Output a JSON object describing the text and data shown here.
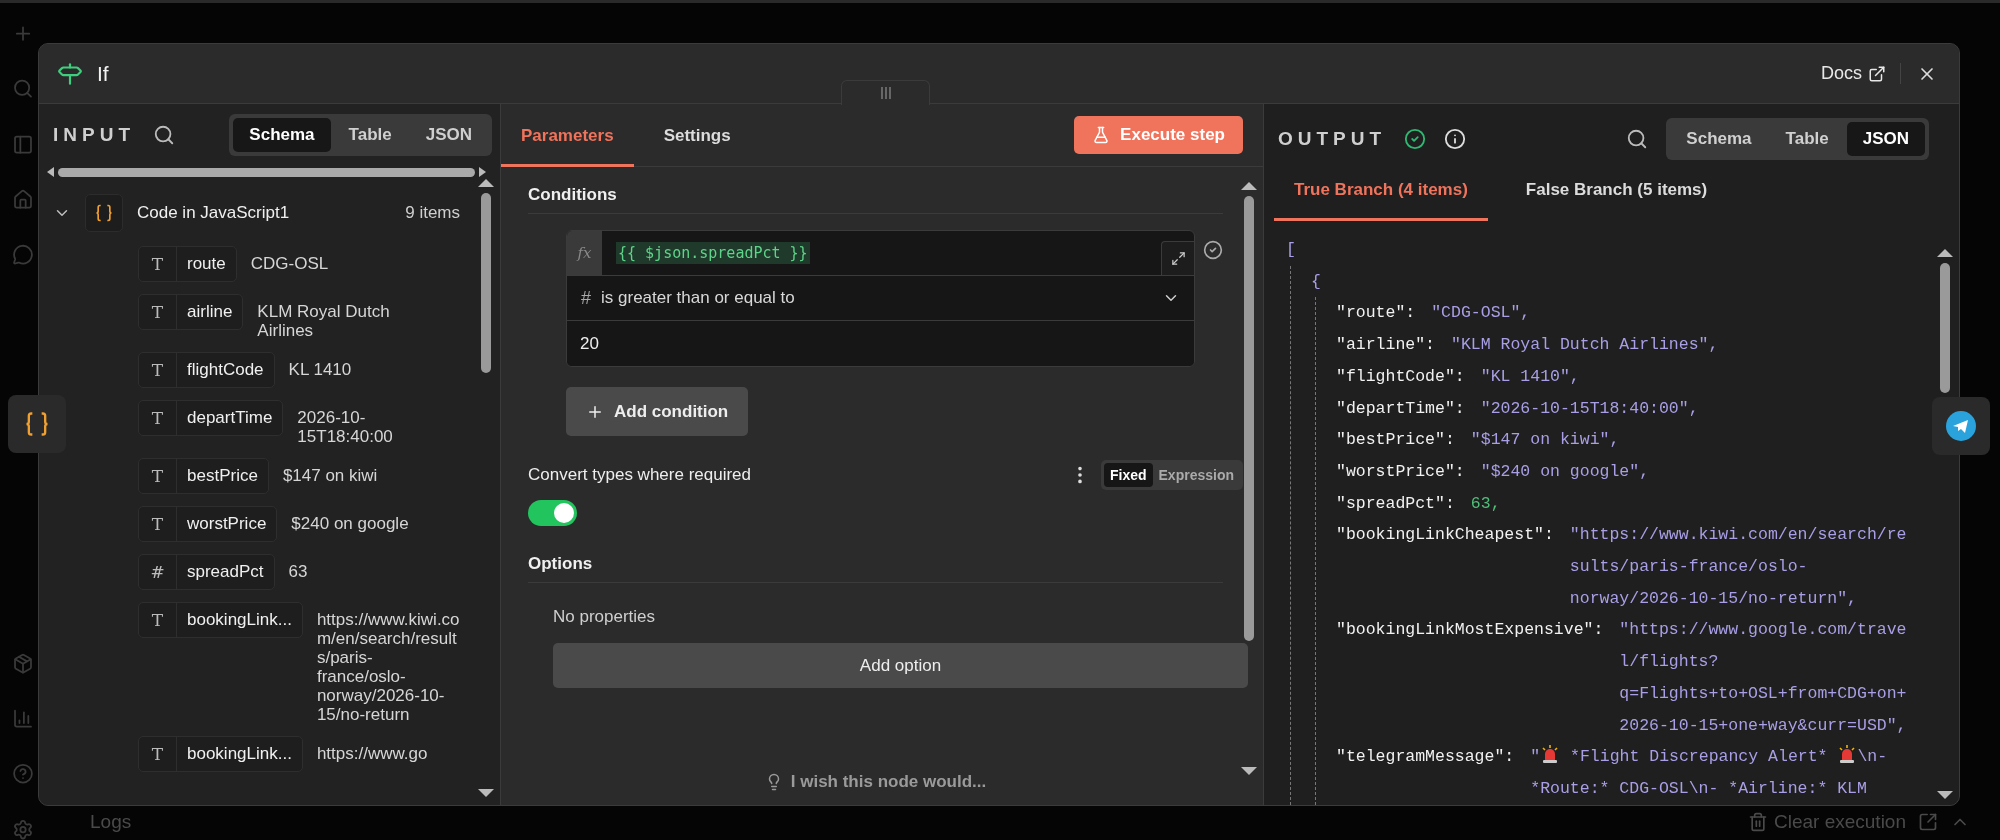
{
  "window": {
    "title": "If",
    "docs_link": "Docs"
  },
  "input": {
    "title": "INPUT",
    "views": [
      {
        "label": "Schema",
        "selected": true
      },
      {
        "label": "Table",
        "selected": false
      },
      {
        "label": "JSON",
        "selected": false
      }
    ],
    "source": {
      "name": "Code in JavaScript1",
      "count": "9 items",
      "expanded": true
    },
    "fields": [
      {
        "type_symbol": "T",
        "name": "route",
        "value": "CDG-OSL"
      },
      {
        "type_symbol": "T",
        "name": "airline",
        "value": "KLM Royal Dutch Airlines"
      },
      {
        "type_symbol": "T",
        "name": "flightCode",
        "value": "KL 1410"
      },
      {
        "type_symbol": "T",
        "name": "departTime",
        "value": "2026-10-15T18:40:00"
      },
      {
        "type_symbol": "T",
        "name": "bestPrice",
        "value": "$147 on kiwi"
      },
      {
        "type_symbol": "T",
        "name": "worstPrice",
        "value": "$240 on google"
      },
      {
        "type_symbol": "#",
        "name": "spreadPct",
        "value": "63"
      },
      {
        "type_symbol": "T",
        "name": "bookingLink...",
        "value": "https://www.kiwi.com/en/search/results/paris-france/oslo-norway/2026-10-15/no-return"
      },
      {
        "type_symbol": "T",
        "name": "bookingLink...",
        "value": "https://www.go"
      }
    ]
  },
  "parameters": {
    "tabs": [
      {
        "label": "Parameters",
        "selected": true
      },
      {
        "label": "Settings",
        "selected": false
      }
    ],
    "execute_button": "Execute step",
    "conditions": {
      "title": "Conditions",
      "expression_badge": "fx",
      "expression": "{{ $json.spreadPct }}",
      "operator_symbol": "#",
      "operator": "is greater than or equal to",
      "value": "20",
      "add_button": "Add condition"
    },
    "convert": {
      "label": "Convert types where required",
      "on": true,
      "modes": [
        {
          "label": "Fixed",
          "selected": true
        },
        {
          "label": "Expression",
          "selected": false
        }
      ]
    },
    "options": {
      "title": "Options",
      "empty_text": "No properties",
      "add_button": "Add option"
    },
    "feedback": "I wish this node would..."
  },
  "output": {
    "title": "OUTPUT",
    "views": [
      {
        "label": "Schema",
        "selected": false
      },
      {
        "label": "Table",
        "selected": false
      },
      {
        "label": "JSON",
        "selected": true
      }
    ],
    "branches": [
      {
        "label": "True Branch (4 items)",
        "selected": true
      },
      {
        "label": "False Branch (5 items)",
        "selected": false
      }
    ],
    "json_view": {
      "open": "[",
      "children": [
        {
          "open": "{",
          "children": [
            {
              "kind": "string",
              "key": "\"route\":",
              "value": "\"CDG-OSL\","
            },
            {
              "kind": "string",
              "key": "\"airline\":",
              "value": "\"KLM Royal Dutch Airlines\","
            },
            {
              "kind": "string",
              "key": "\"flightCode\":",
              "value": "\"KL 1410\","
            },
            {
              "kind": "string",
              "key": "\"departTime\":",
              "value": "\"2026-10-15T18:40:00\","
            },
            {
              "kind": "string",
              "key": "\"bestPrice\":",
              "value": "\"$147 on kiwi\","
            },
            {
              "kind": "string",
              "key": "\"worstPrice\":",
              "value": "\"$240 on google\","
            },
            {
              "kind": "number",
              "key": "\"spreadPct\":",
              "value": "63,"
            },
            {
              "kind": "string",
              "key": "\"bookingLinkCheapest\":",
              "value": "\"https://www.kiwi.com/en/search/results/paris-france/oslo-norway/2026-10-15/no-return\","
            },
            {
              "kind": "string",
              "key": "\"bookingLinkMostExpensive\":",
              "value": "\"https://www.google.com/travel/flights?q=Flights+to+OSL+from+CDG+on+2026-10-15+one+way&curr=USD\","
            },
            {
              "kind": "message",
              "key": "\"telegramMessage\":",
              "segments": [
                {
                  "kind": "text",
                  "text": "\""
                },
                {
                  "kind": "siren"
                },
                {
                  "kind": "text",
                  "text": " *Flight Discrepancy Alert* "
                },
                {
                  "kind": "siren"
                },
                {
                  "kind": "text",
                  "text": "\\n- *Route:* CDG-OSL\\n- *Airline:* KLM"
                }
              ]
            }
          ]
        }
      ]
    }
  },
  "background": {
    "logs_label": "Logs",
    "clear_button": "Clear execution"
  }
}
